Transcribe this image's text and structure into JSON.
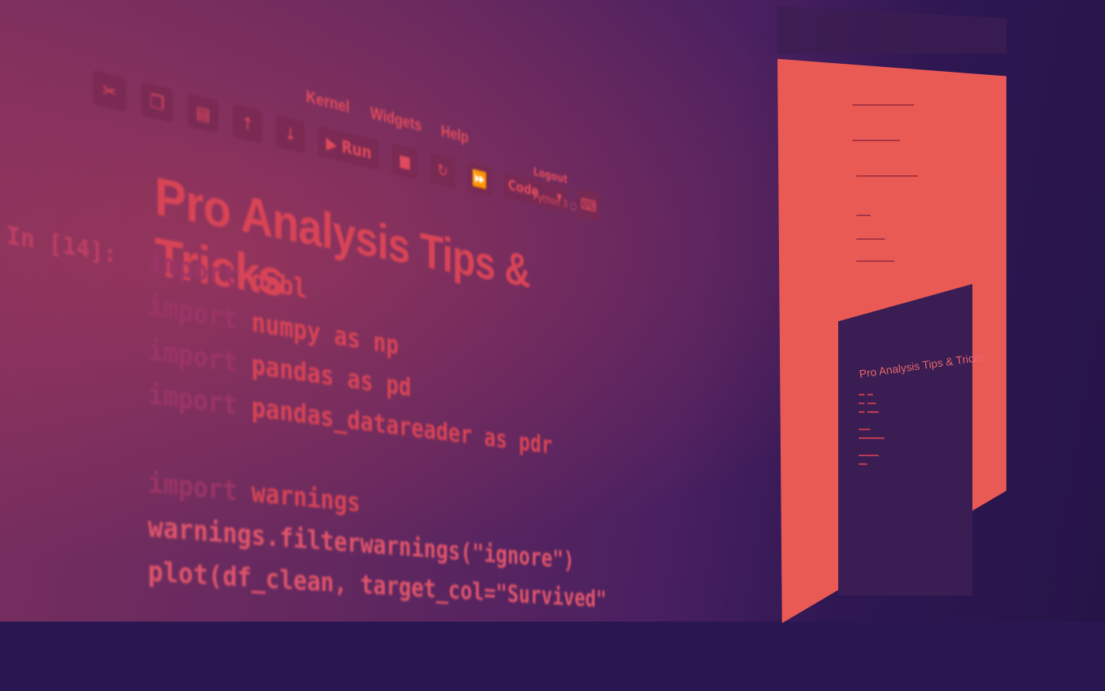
{
  "menu": [
    "Kernel",
    "Widgets",
    "Help"
  ],
  "toolbar": {
    "run_label": "Run",
    "cell_type": "Code"
  },
  "header": {
    "logout_label": "Logout",
    "kernel_name": "Python 3"
  },
  "notebook": {
    "heading": "Pro Analysis Tips & Tricks",
    "prompt": "In [14]:",
    "code_lines": [
      {
        "kw": "import ",
        "rest": "dabl"
      },
      {
        "kw": "import ",
        "rest": "numpy as np"
      },
      {
        "kw": "import ",
        "rest": "pandas as pd"
      },
      {
        "kw": "import ",
        "rest": "pandas_datareader as pdr"
      },
      {
        "kw": "import ",
        "rest": "warnings"
      },
      {
        "kw": "",
        "rest": "warnings.filterwarnings(\"ignore\")"
      },
      {
        "kw": "",
        "rest": "plot(df_clean, target_col=\"Survived\""
      }
    ]
  },
  "second_screen": {
    "mini_title": "Pro Analysis Tips & Tricks"
  },
  "colors": {
    "accent": "#d94356",
    "keyword": "#9b3466",
    "background": "#2a1650"
  }
}
